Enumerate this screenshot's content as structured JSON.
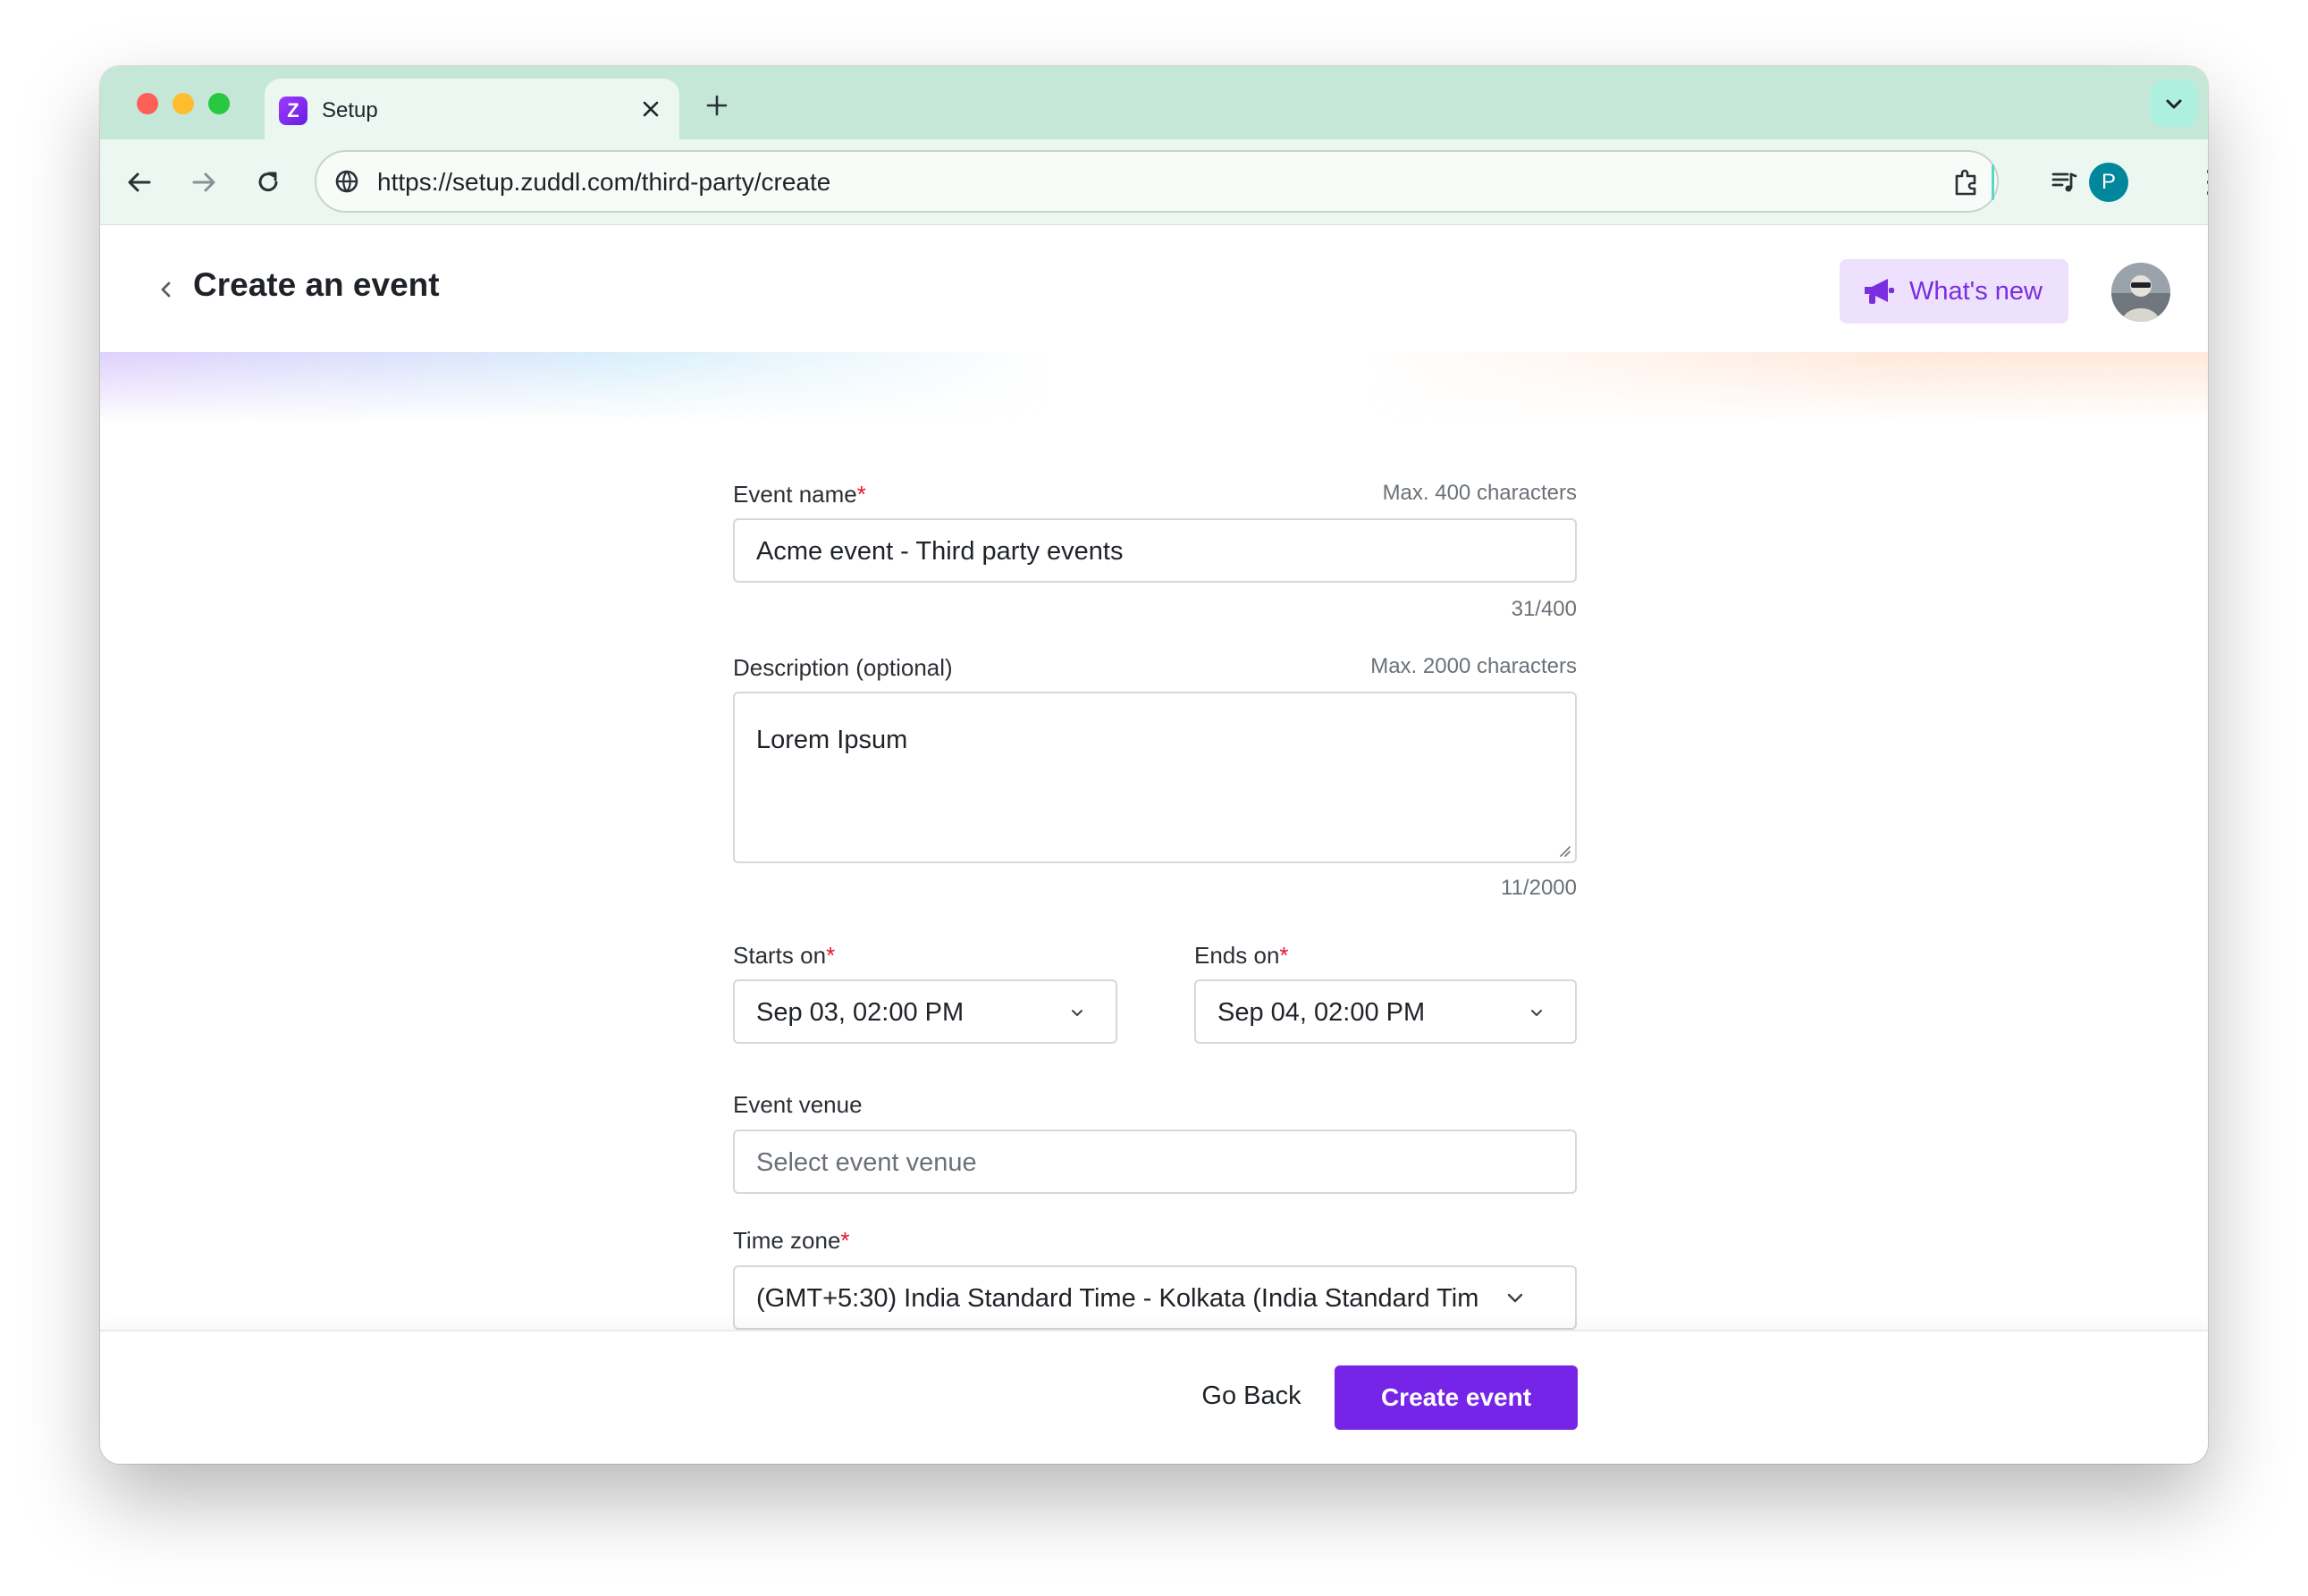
{
  "browser": {
    "tab_title": "Setup",
    "favicon_letter": "Z",
    "url": "https://setup.zuddl.com/third-party/create",
    "profile_initial": "P"
  },
  "header": {
    "title": "Create an event",
    "whats_new_label": "What's new"
  },
  "form": {
    "event_name": {
      "label": "Event name",
      "required_mark": "*",
      "max_hint": "Max. 400 characters",
      "value": "Acme event - Third party events",
      "counter": "31/400"
    },
    "description": {
      "label": "Description (optional)",
      "max_hint": "Max. 2000 characters",
      "value": "Lorem Ipsum",
      "counter": "11/2000"
    },
    "starts_on": {
      "label": "Starts on",
      "required_mark": "*",
      "value": "Sep 03, 02:00 PM"
    },
    "ends_on": {
      "label": "Ends on",
      "required_mark": "*",
      "value": "Sep 04, 02:00 PM"
    },
    "event_venue": {
      "label": "Event venue",
      "placeholder": "Select event venue"
    },
    "time_zone": {
      "label": "Time zone",
      "required_mark": "*",
      "value": "(GMT+5:30) India Standard Time - Kolkata (India Standard Tim"
    }
  },
  "footer": {
    "go_back_label": "Go Back",
    "create_label": "Create event"
  },
  "colors": {
    "tab_strip": "#c5e7d8",
    "toolbar": "#ecf7f1",
    "primary": "#7624e8",
    "required": "#e5142c",
    "whats_new_bg": "#ede1fd",
    "profile": "#00879b"
  }
}
